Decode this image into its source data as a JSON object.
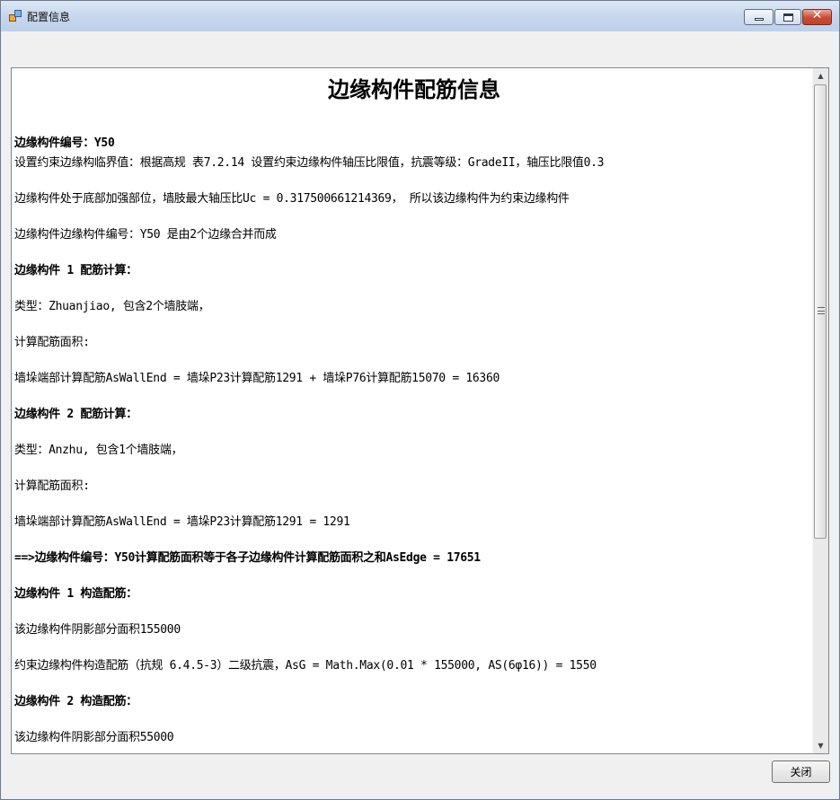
{
  "window": {
    "title": "配置信息",
    "icons": {
      "app": "app-window-icon",
      "minimize": "minimize-icon",
      "maximize": "maximize-icon",
      "close": "close-x-icon"
    },
    "close_glyph": "✕"
  },
  "document": {
    "title": "边缘构件配筋信息",
    "lines": [
      {
        "text": "边缘构件编号：Y50",
        "bold": true
      },
      {
        "text": "设置约束边缘构临界值：根据高规 表7.2.14 设置约束边缘构件轴压比限值，抗震等级：GradeII，轴压比限值0.3",
        "bold": false
      },
      {
        "text": "边缘构件处于底部加强部位，墙肢最大轴压比Uc = 0.317500661214369， 所以该边缘构件为约束边缘构件",
        "bold": false
      },
      {
        "text": "边缘构件边缘构件编号：Y50 是由2个边缘合并而成",
        "bold": false
      },
      {
        "text": "边缘构件 1 配筋计算：",
        "bold": true
      },
      {
        "text": " 类型：Zhuanjiao, 包含2个墙肢端，",
        "bold": false
      },
      {
        "text": "计算配筋面积:",
        "bold": false
      },
      {
        "text": "墙垛端部计算配筋AsWallEnd = 墙垛P23计算配筋1291 + 墙垛P76计算配筋15070 = 16360",
        "bold": false
      },
      {
        "text": "边缘构件 2 配筋计算：",
        "bold": true
      },
      {
        "text": " 类型：Anzhu, 包含1个墙肢端，",
        "bold": false
      },
      {
        "text": "计算配筋面积:",
        "bold": false
      },
      {
        "text": "墙垛端部计算配筋AsWallEnd = 墙垛P23计算配筋1291 = 1291",
        "bold": false
      },
      {
        "text": "==>边缘构件编号：Y50计算配筋面积等于各子边缘构件计算配筋面积之和AsEdge = 17651",
        "bold": true
      },
      {
        "text": "边缘构件 1 构造配筋：",
        "bold": true
      },
      {
        "text": "该边缘构件阴影部分面积155000",
        "bold": false
      },
      {
        "text": "约束边缘构件构造配筋（抗规 6.4.5-3）二级抗震，AsG = Math.Max(0.01 * 155000, AS(6φ16)) = 1550",
        "bold": false
      },
      {
        "text": "边缘构件 2 构造配筋：",
        "bold": true
      },
      {
        "text": "该边缘构件阴影部分面积55000",
        "bold": false
      }
    ]
  },
  "scrollbar": {
    "up_arrow": "▲",
    "down_arrow": "▼"
  },
  "buttons": {
    "close_label": "关闭"
  }
}
